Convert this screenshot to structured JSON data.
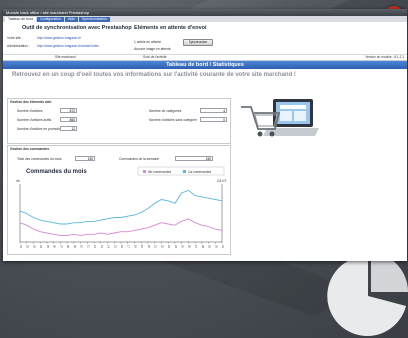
{
  "window": {
    "title": "Module back office / site marchand Prestashop"
  },
  "tabs": [
    {
      "label": "Tableau de bord",
      "active": true
    },
    {
      "label": "Configuration",
      "active": false
    },
    {
      "label": "Aide",
      "active": false
    },
    {
      "label": "Synchronisation",
      "active": false
    }
  ],
  "sync": {
    "title": "Outil de synchronisation avec Prestashop",
    "site_label": "Votre site :",
    "site_url": "http://www.gestion-magasin.fr/",
    "admin_label": "Administration :",
    "admin_url": "http://www.gestion-magasin.fr/admin/index"
  },
  "pending": {
    "title": "Eléments en attente d'envoi",
    "items_text": "1 article en attente",
    "images_text": "Aucune image en attente",
    "sync_button": "Synchroniser"
  },
  "footer": {
    "left": "Site marchand",
    "mid": "Suivi de l'activité",
    "right": "Version du module : 6.1.2.1"
  },
  "dashboard": {
    "title": "Tableau de bord / Statistiques",
    "tagline": "Retrouvez en un coup d'oeil toutes vos informations sur l'activité courante de votre site marchand !"
  },
  "articles": {
    "title": "Gestion des éléments web",
    "rows": [
      {
        "label": "Nombre d'articles",
        "value": "872"
      },
      {
        "label": "Nombre d'articles actifs",
        "value": "860"
      },
      {
        "label": "Nombre d'articles en promotion",
        "value": "12"
      }
    ],
    "categories": [
      {
        "label": "Nombre de catégories",
        "value": "4"
      },
      {
        "label": "Nombre d'articles sans catégorie",
        "value": "0"
      }
    ]
  },
  "orders": {
    "title": "Gestion des commandes",
    "month_label": "Total des commandes du mois",
    "month_value": "150",
    "week_label": "Commandes de la semaine",
    "week_value": "150"
  },
  "colors": {
    "accent": "#2d5fb0",
    "line_new": "#d98ad6",
    "line_sent": "#5bb8e0"
  },
  "chart_data": {
    "type": "line",
    "title": "Commandes du mois",
    "y_left_label": "nb",
    "y_right_label": "CA HT",
    "legend_position": "top-right",
    "grid": false,
    "x": [
      "01",
      "02",
      "03",
      "04",
      "05",
      "06",
      "07",
      "08",
      "09",
      "10",
      "11",
      "12",
      "13",
      "14",
      "15",
      "16",
      "17",
      "18",
      "19",
      "20",
      "21",
      "22",
      "23",
      "24",
      "25",
      "26",
      "27",
      "28",
      "29",
      "30",
      "31"
    ],
    "series": [
      {
        "name": "Ca commandes",
        "color": "#5bb8e0",
        "values": [
          24,
          22,
          19,
          17,
          16,
          15,
          14,
          14,
          15,
          15,
          16,
          16,
          17,
          18,
          19,
          19,
          20,
          21,
          23,
          26,
          30,
          33,
          32,
          30,
          38,
          40,
          36,
          35,
          34,
          33,
          32
        ]
      },
      {
        "name": "Nb commandes",
        "color": "#d98ad6",
        "values": [
          15,
          13,
          10,
          8,
          7,
          6,
          5,
          5,
          6,
          5,
          6,
          6,
          7,
          6,
          7,
          8,
          8,
          9,
          10,
          11,
          13,
          15,
          14,
          13,
          16,
          18,
          15,
          13,
          12,
          10,
          9
        ]
      }
    ],
    "ylim": [
      0,
      45
    ]
  }
}
